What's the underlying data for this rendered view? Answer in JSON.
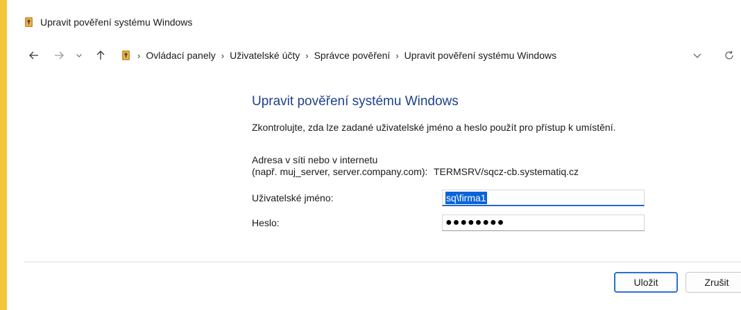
{
  "window": {
    "title": "Upravit pověření systému Windows",
    "accent_color": "#f3c53a"
  },
  "nav": {
    "back_icon": "arrow-left-icon",
    "forward_icon": "arrow-right-icon",
    "recent_icon": "chevron-down-icon",
    "up_icon": "arrow-up-icon",
    "breadcrumbs": [
      "Ovládací panely",
      "Uživatelské účty",
      "Správce pověření",
      "Upravit pověření systému Windows"
    ],
    "dropdown_icon": "chevron-down-icon",
    "refresh_icon": "refresh-icon"
  },
  "form": {
    "heading": "Upravit pověření systému Windows",
    "subtitle": "Zkontrolujte, zda lze zadané uživatelské jméno a heslo použít pro přístup k umístění.",
    "address_label_line1": "Adresa v síti nebo v internetu",
    "address_label_line2": "(např. muj_server, server.company.com):",
    "address_value": "TERMSRV/sqcz-cb.systematiq.cz",
    "username_label": "Uživatelské jméno:",
    "username_value": "sq\\firma1",
    "password_label": "Heslo:",
    "password_mask": "●●●●●●●●"
  },
  "footer": {
    "save_label": "Uložit",
    "cancel_label": "Zrušit"
  },
  "colors": {
    "heading": "#1e3f8f",
    "focus": "#2464c8",
    "selection": "#0a64d8"
  }
}
